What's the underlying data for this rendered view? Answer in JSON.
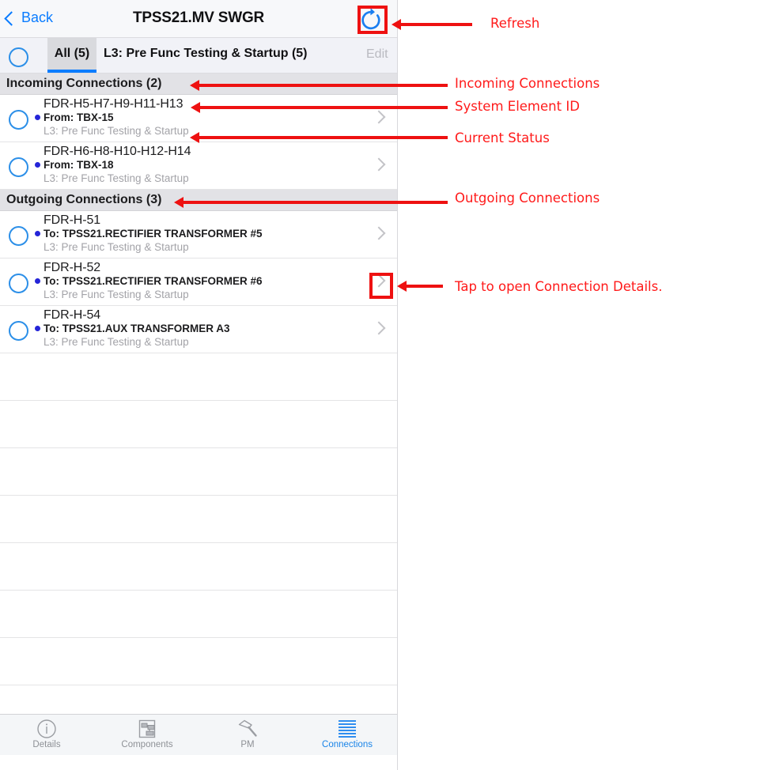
{
  "navbar": {
    "back_label": "Back",
    "title": "TPSS21.MV SWGR",
    "refresh_icon": "refresh-circular-arrow-icon"
  },
  "filterbar": {
    "select_all_icon": "empty-circle-checkbox-icon",
    "tab_all_label": "All (5)",
    "tab_stage_label": "L3: Pre Func Testing & Startup (5)",
    "edit_label": "Edit"
  },
  "sections": [
    {
      "header": "Incoming Connections (2)",
      "rows": [
        {
          "element_id": "FDR-H5-H7-H9-H11-H13",
          "peer": "From: TBX-15",
          "status": "L3: Pre Func Testing & Startup"
        },
        {
          "element_id": "FDR-H6-H8-H10-H12-H14",
          "peer": "From: TBX-18",
          "status": "L3: Pre Func Testing & Startup"
        }
      ]
    },
    {
      "header": "Outgoing Connections (3)",
      "rows": [
        {
          "element_id": "FDR-H-51",
          "peer": "To: TPSS21.RECTIFIER TRANSFORMER #5",
          "status": "L3: Pre Func Testing & Startup"
        },
        {
          "element_id": "FDR-H-52",
          "peer": "To: TPSS21.RECTIFIER TRANSFORMER #6",
          "status": "L3: Pre Func Testing & Startup"
        },
        {
          "element_id": "FDR-H-54",
          "peer": "To: TPSS21.AUX TRANSFORMER A3",
          "status": "L3: Pre Func Testing & Startup"
        }
      ]
    }
  ],
  "empty_row_count": 8,
  "tabbar": {
    "items": [
      {
        "label": "Details",
        "icon": "info-circle-icon",
        "active": false
      },
      {
        "label": "Components",
        "icon": "components-diagram-icon",
        "active": false
      },
      {
        "label": "PM",
        "icon": "hammer-icon",
        "active": false
      },
      {
        "label": "Connections",
        "icon": "list-lines-icon",
        "active": true
      }
    ]
  },
  "annotations": {
    "refresh": "Refresh",
    "incoming": "Incoming Connections",
    "system_element_id": "System Element ID",
    "current_status": "Current Status",
    "outgoing": "Outgoing Connections",
    "tap_details": "Tap to open Connection Details."
  },
  "colors": {
    "accent_blue": "#0a7cff",
    "annotation_red": "#ee1111",
    "status_dot_blue": "#2525d8",
    "muted_gray": "#a3a3a8"
  }
}
